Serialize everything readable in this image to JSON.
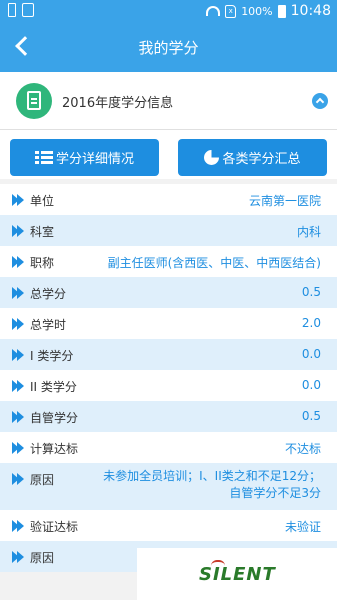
{
  "status_bar": {
    "battery": "100%",
    "time": "10:48"
  },
  "header": {
    "title": "我的学分"
  },
  "info": {
    "title": "2016年度学分信息"
  },
  "buttons": {
    "detail": "学分详细情况",
    "summary": "各类学分汇总"
  },
  "rows": [
    {
      "label": "单位",
      "value": "云南第一医院"
    },
    {
      "label": "科室",
      "value": "内科"
    },
    {
      "label": "职称",
      "value": "副主任医师(含西医、中医、中西医结合)"
    },
    {
      "label": "总学分",
      "value": "0.5"
    },
    {
      "label": "总学时",
      "value": "2.0"
    },
    {
      "label": "I 类学分",
      "value": "0.0"
    },
    {
      "label": "II 类学分",
      "value": "0.0"
    },
    {
      "label": "自管学分",
      "value": "0.5"
    },
    {
      "label": "计算达标",
      "value": "不达标"
    },
    {
      "label": "原因",
      "value": "未参加全员培训；I、II类之和不足12分；自管学分不足3分"
    },
    {
      "label": "验证达标",
      "value": "未验证"
    },
    {
      "label": "原因",
      "value": ""
    }
  ],
  "watermark": {
    "text": "SILENT"
  },
  "colors": {
    "primary": "#3aa3e8",
    "button": "#1e8ee0",
    "accent_green": "#2fb67b",
    "row_alt": "#dfeffb"
  }
}
